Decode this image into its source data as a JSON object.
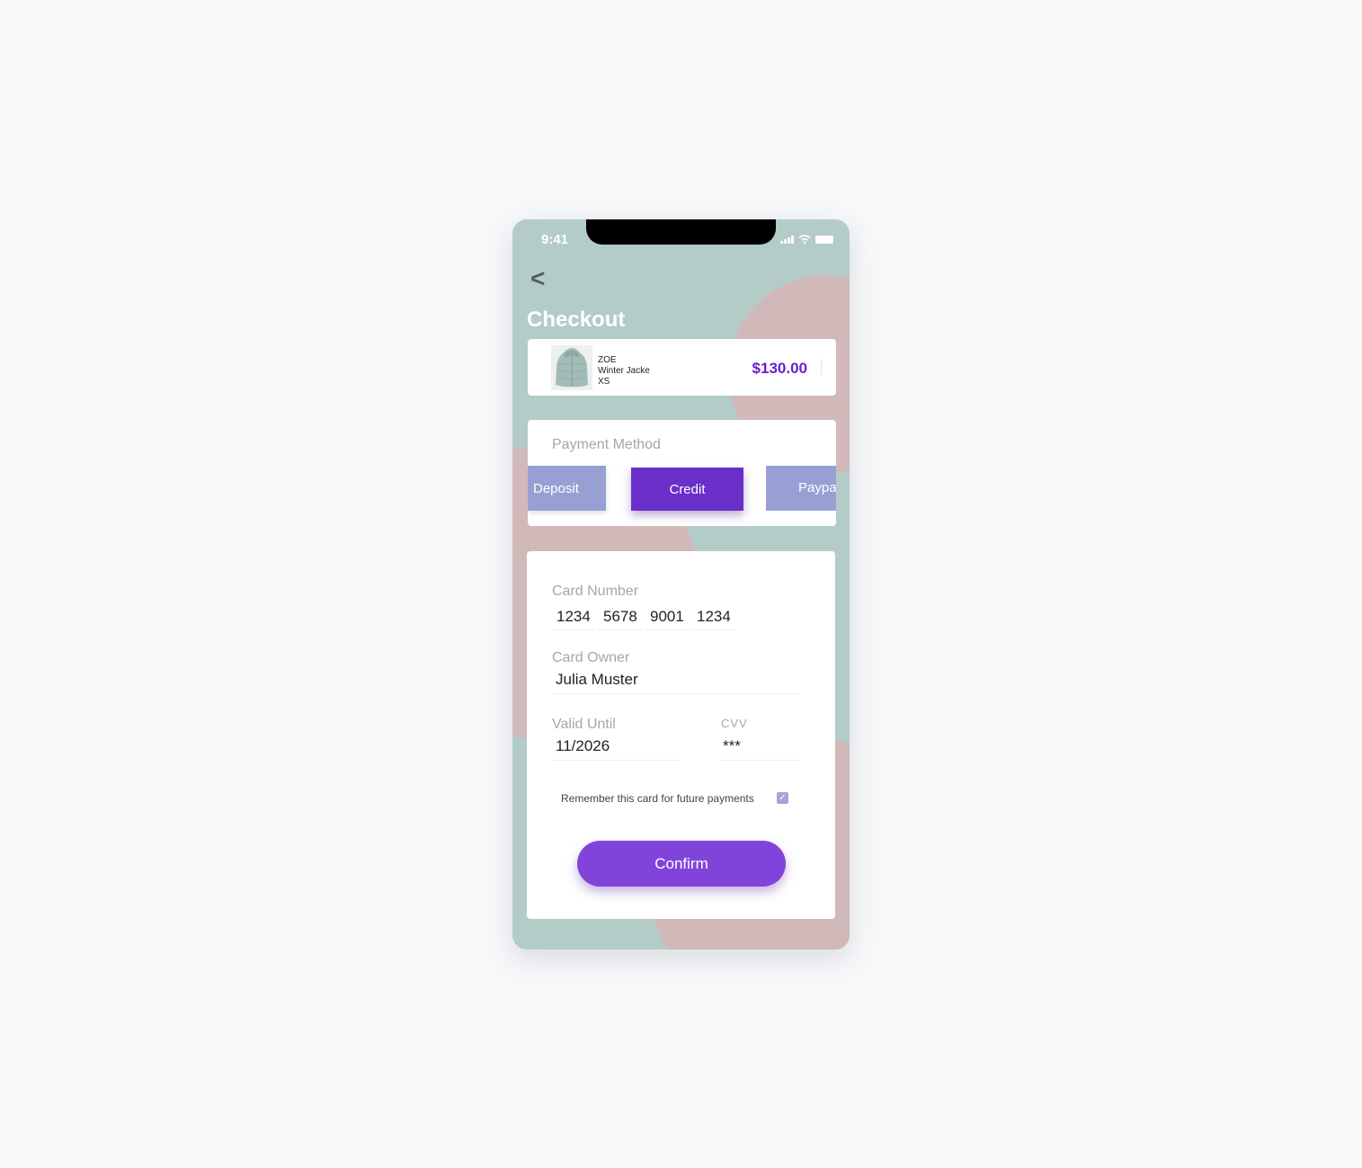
{
  "status_bar": {
    "time": "9:41"
  },
  "header": {
    "back_label": "<",
    "title": "Checkout"
  },
  "product": {
    "brand": "ZOE",
    "name": "Winter Jacke",
    "size": "XS",
    "price": "$130.00",
    "image_icon": "jacket-icon"
  },
  "payment": {
    "label": "Payment Method",
    "options": [
      "Deposit",
      "Credit",
      "Paypa"
    ],
    "selected": "Credit"
  },
  "form": {
    "card_number_label": "Card Number",
    "card_number": [
      "1234",
      "5678",
      "9001",
      "1234"
    ],
    "owner_label": "Card Owner",
    "owner_value": "Julia Muster",
    "valid_label": "Valid Until",
    "valid_value": "11/2026",
    "cvv_label": "CVV",
    "cvv_value": "***",
    "remember_label": "Remember this card for future payments",
    "remember_checked": true,
    "confirm_label": "Confirm"
  },
  "colors": {
    "background": "#b4ccc8",
    "blob": "#d1b8b9",
    "accent": "#6b2fc9",
    "price": "#6a1ed2",
    "option": "#98a0d3",
    "confirm": "#8144db"
  }
}
